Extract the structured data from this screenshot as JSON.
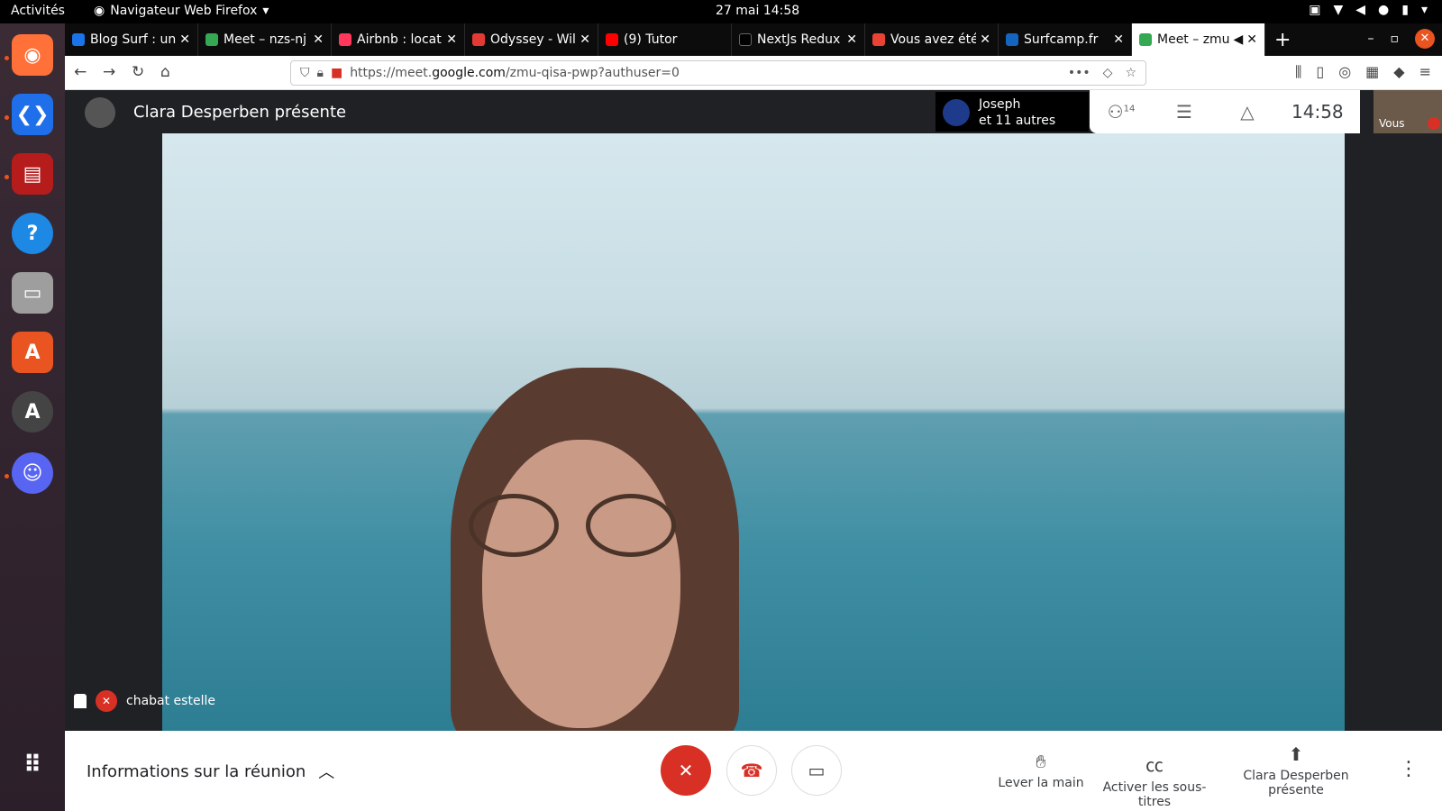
{
  "topbar": {
    "activities": "Activités",
    "app_name": "Navigateur Web Firefox",
    "clock": "27 mai  14:58"
  },
  "tabs": [
    {
      "label": "Blog Surf : un",
      "color": "#1a73e8"
    },
    {
      "label": "Meet – nzs-nj",
      "color": "#34a853"
    },
    {
      "label": "Airbnb : locat",
      "color": "#ff385c"
    },
    {
      "label": "Odyssey - Wil",
      "color": "#e53935"
    },
    {
      "label": "(9) Tutor",
      "color": "#ff0000"
    },
    {
      "label": "NextJs Redux",
      "color": "#000000"
    },
    {
      "label": "Vous avez été",
      "color": "#ea4335"
    },
    {
      "label": "Surfcamp.fr",
      "color": "#1565c0"
    },
    {
      "label": "Meet – zmu",
      "color": "#34a853"
    }
  ],
  "navbar": {
    "url_prefix": "https://meet.",
    "url_domain": "google.com",
    "url_path": "/zmu-qisa-pwp?authuser=0"
  },
  "meet": {
    "presenter_title": "Clara Desperben présente",
    "participant_name": "Joseph",
    "participant_others": "et 11 autres",
    "participant_count": "14",
    "time": "14:58",
    "self_label": "Vous",
    "speaker_name": "chabat estelle"
  },
  "bottom": {
    "info_label": "Informations sur la réunion",
    "raise_hand": "Lever la main",
    "captions": "Activer les sous-titres",
    "presenting_line1": "Clara Desperben",
    "presenting_line2": "présente"
  }
}
